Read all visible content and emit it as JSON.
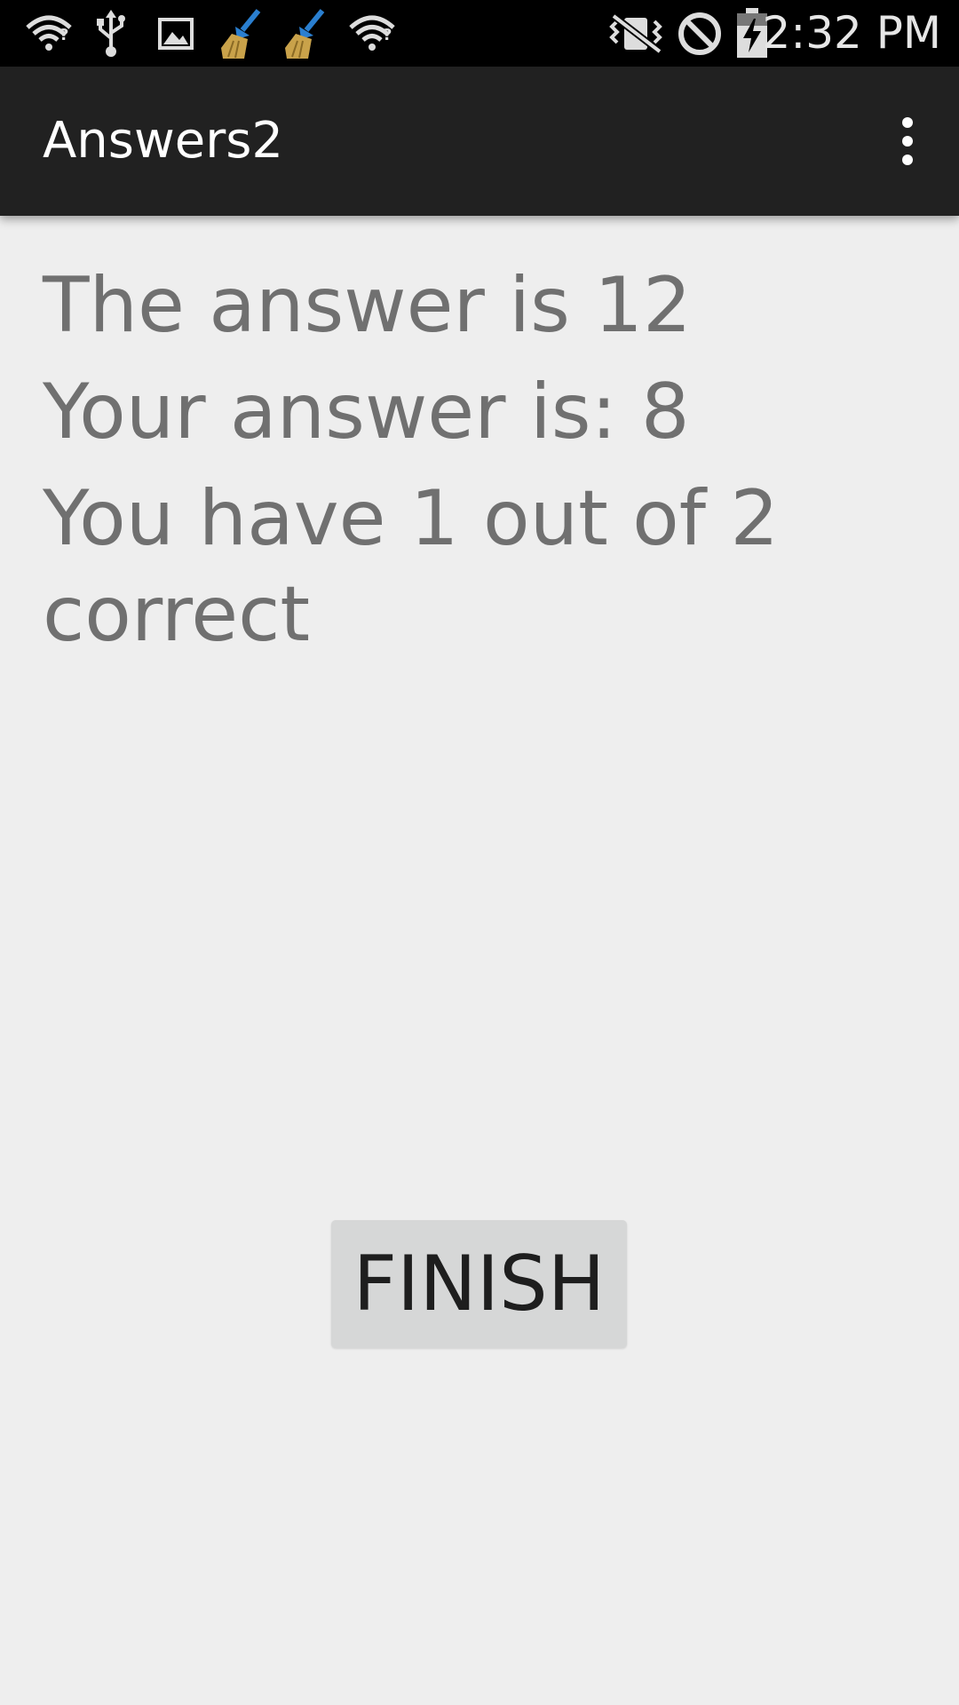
{
  "status_bar": {
    "time": "2:32 PM",
    "icons": [
      "wifi-question-icon",
      "usb-icon",
      "image-icon",
      "broom-icon",
      "broom-icon",
      "wifi-question-icon",
      "vibrate-icon",
      "blocked-icon",
      "battery-charging-icon"
    ]
  },
  "app_bar": {
    "title": "Answers2",
    "menu_icon": "overflow-menu-icon"
  },
  "main": {
    "correct_answer": "The answer is 12",
    "user_answer": "Your answer is: 8",
    "score": "You have 1 out of 2 correct"
  },
  "actions": {
    "finish_label": "FINISH"
  },
  "colors": {
    "status_bar_bg": "#000000",
    "app_bar_bg": "#212121",
    "screen_bg": "#eeeeee",
    "text_gray": "#707070",
    "button_bg": "#d6d7d7"
  }
}
